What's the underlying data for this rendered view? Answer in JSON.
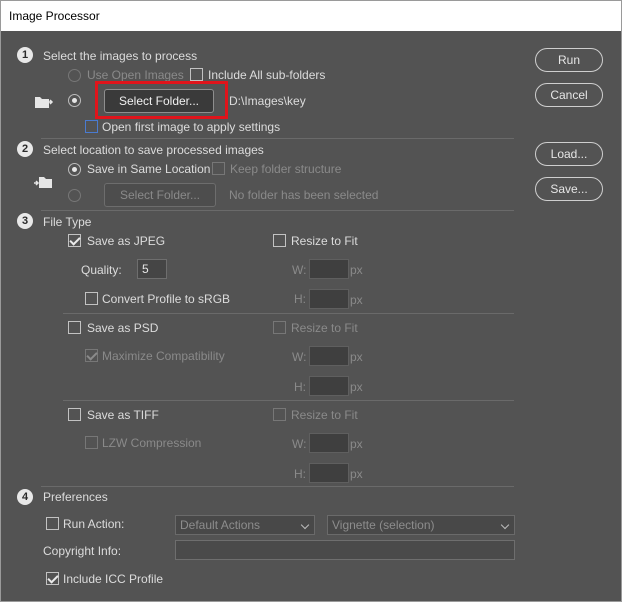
{
  "window": {
    "title": "Image Processor"
  },
  "section1": {
    "number": "1",
    "heading": "Select the images to process",
    "use_open_images": "Use Open Images",
    "include_subfolders": "Include All sub-folders",
    "select_folder_button": "Select Folder...",
    "folder_path": "D:\\Images\\key",
    "open_first_image": "Open first image to apply settings"
  },
  "section2": {
    "number": "2",
    "heading": "Select location to save processed images",
    "save_same_location": "Save in Same Location",
    "keep_folder_structure": "Keep folder structure",
    "select_folder_button": "Select Folder...",
    "no_folder_text": "No folder has been selected"
  },
  "section3": {
    "number": "3",
    "heading": "File Type",
    "jpeg": {
      "label": "Save as JPEG",
      "checked": true,
      "resize": "Resize to Fit",
      "quality_label": "Quality:",
      "quality_value": "5",
      "convert_profile": "Convert Profile to sRGB",
      "w": "W:",
      "h": "H:",
      "px": "px"
    },
    "psd": {
      "label": "Save as PSD",
      "resize": "Resize to Fit",
      "maximize": "Maximize Compatibility",
      "w": "W:",
      "h": "H:",
      "px": "px"
    },
    "tiff": {
      "label": "Save as TIFF",
      "resize": "Resize to Fit",
      "lzw": "LZW Compression",
      "w": "W:",
      "h": "H:",
      "px": "px"
    }
  },
  "section4": {
    "number": "4",
    "heading": "Preferences",
    "run_action": "Run Action:",
    "action_set": "Default Actions",
    "action": "Vignette (selection)",
    "copyright_label": "Copyright Info:",
    "copyright_value": "",
    "include_icc": "Include ICC Profile"
  },
  "side_buttons": {
    "run": "Run",
    "cancel": "Cancel",
    "load": "Load...",
    "save": "Save..."
  },
  "colors": {
    "highlight": "#e0141b",
    "background": "#535353"
  }
}
